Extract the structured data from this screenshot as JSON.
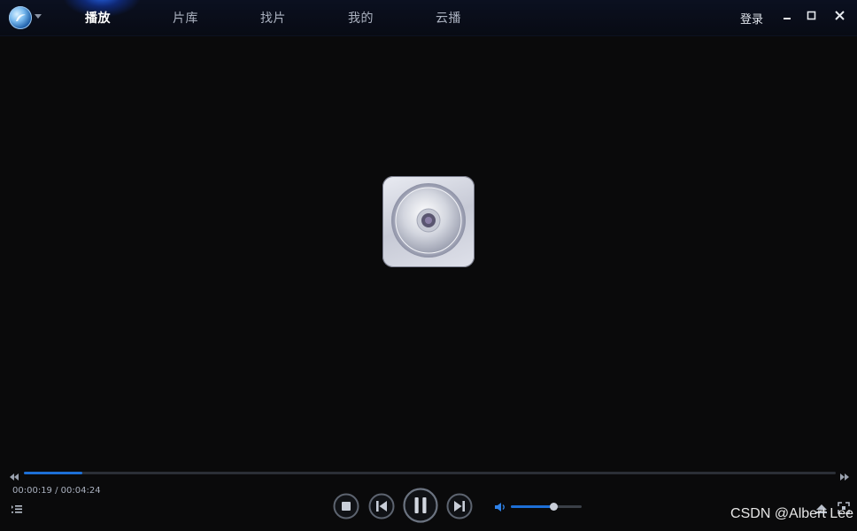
{
  "nav": {
    "tabs": [
      {
        "label": "播放",
        "active": true
      },
      {
        "label": "片库",
        "active": false
      },
      {
        "label": "找片",
        "active": false
      },
      {
        "label": "我的",
        "active": false
      },
      {
        "label": "云播",
        "active": false
      }
    ],
    "login_label": "登录"
  },
  "window_controls": {
    "minimize_icon": "minimize-icon",
    "maximize_icon": "maximize-icon",
    "close_icon": "close-icon"
  },
  "player": {
    "center_icon": "disc-icon",
    "current_time": "00:00:19",
    "total_time": "00:04:24",
    "time_display": "00:00:19 / 00:04:24",
    "progress_fraction": 0.072,
    "volume_fraction": 0.6,
    "state": "playing"
  },
  "colors": {
    "accent": "#1d6fd6",
    "background": "#0a0a0b",
    "titlebar": "#0b1020"
  },
  "watermark": "CSDN @Albert Lee"
}
